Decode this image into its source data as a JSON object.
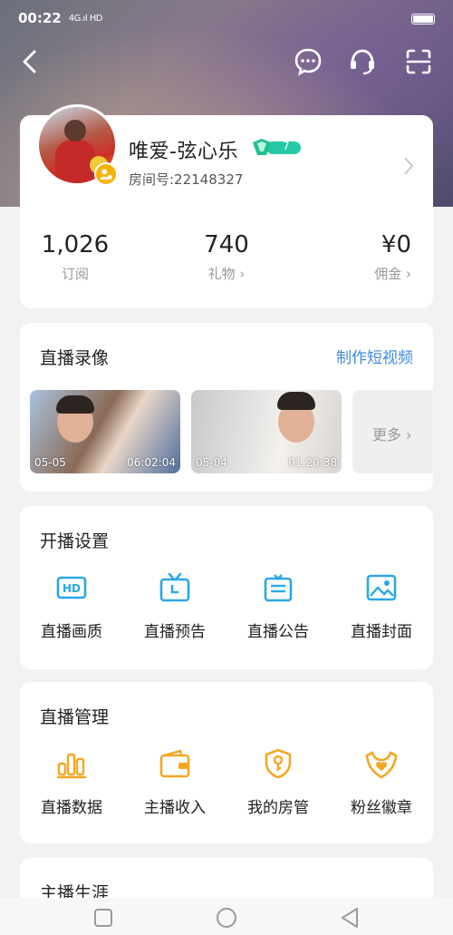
{
  "status_bar": {
    "time": "00:22",
    "signal": "4G.ıl HD"
  },
  "top_bar": {
    "back_icon": "chevron-left-icon",
    "actions": [
      "chat-bubble-icon",
      "headset-icon",
      "scan-icon"
    ]
  },
  "profile": {
    "name": "唯爱-弦心乐",
    "level": "7",
    "room_id": "房间号:22148327"
  },
  "stats": [
    {
      "value": "1,026",
      "label": "订阅"
    },
    {
      "value": "740",
      "label": "礼物 ›"
    },
    {
      "value": "¥0",
      "label": "佣金 ›"
    }
  ],
  "replays": {
    "title": "直播录像",
    "action": "制作短视频",
    "videos": [
      {
        "date": "05-05",
        "duration": "06:02:04"
      },
      {
        "date": "05-04",
        "duration": "01:20:38"
      }
    ],
    "more": "更多 ›"
  },
  "setup": {
    "title": "开播设置",
    "items": [
      {
        "label": "直播画质",
        "icon": "hd-icon"
      },
      {
        "label": "直播预告",
        "icon": "tv-icon"
      },
      {
        "label": "直播公告",
        "icon": "notice-icon"
      },
      {
        "label": "直播封面",
        "icon": "image-icon"
      }
    ],
    "accent": "#2aa7e6"
  },
  "management": {
    "title": "直播管理",
    "items": [
      {
        "label": "直播数据",
        "icon": "bar-chart-icon"
      },
      {
        "label": "主播收入",
        "icon": "wallet-icon"
      },
      {
        "label": "我的房管",
        "icon": "shield-key-icon"
      },
      {
        "label": "粉丝徽章",
        "icon": "heart-badge-icon"
      }
    ],
    "accent": "#f5a623"
  },
  "career": {
    "title": "主播生涯"
  }
}
